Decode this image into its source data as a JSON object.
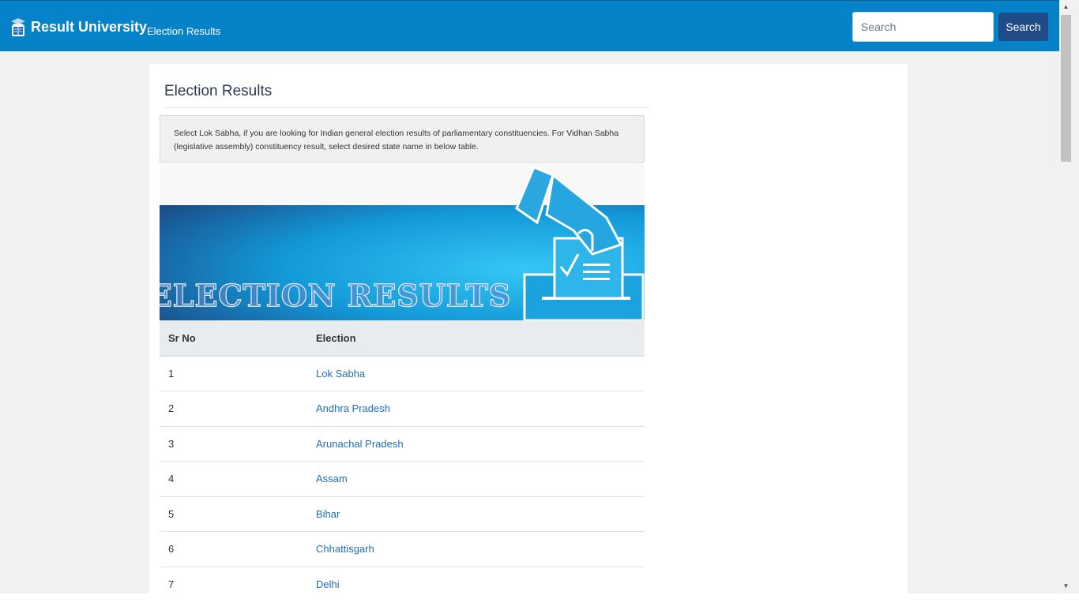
{
  "header": {
    "brand": "Result University",
    "nav_link": "Election Results",
    "search_placeholder": "Search",
    "search_button": "Search"
  },
  "main": {
    "title": "Election Results",
    "info": "Select Lok Sabha, if you are looking for Indian general election results of parliamentary constituencies. For Vidhan Sabha (legislative assembly) constituency result, select desired state name in below table.",
    "banner_text": "ELECTION RESULTS",
    "table": {
      "headers": [
        "Sr No",
        "Election"
      ],
      "rows": [
        {
          "sr": "1",
          "election": "Lok Sabha"
        },
        {
          "sr": "2",
          "election": "Andhra Pradesh"
        },
        {
          "sr": "3",
          "election": "Arunachal Pradesh"
        },
        {
          "sr": "4",
          "election": "Assam"
        },
        {
          "sr": "5",
          "election": "Bihar"
        },
        {
          "sr": "6",
          "election": "Chhattisgarh"
        },
        {
          "sr": "7",
          "election": "Delhi"
        }
      ]
    }
  },
  "colors": {
    "navbar": "#0582c8",
    "search_button": "#1f4c86",
    "link": "#1f6fb6"
  },
  "icons": [
    "graduation-book-icon",
    "ballot-box-icon",
    "scroll-up-arrow-icon",
    "scroll-down-arrow-icon"
  ]
}
